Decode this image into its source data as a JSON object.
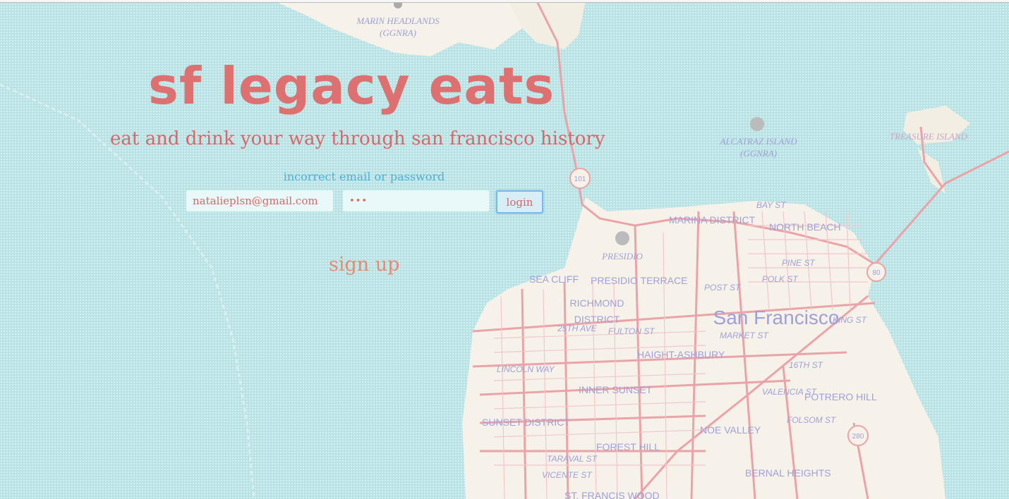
{
  "header": {
    "title": "sf legacy eats",
    "subtitle": "eat and drink your way through san francisco history"
  },
  "login_form": {
    "error_message": "incorrect email or password",
    "email_value": "natalieplsn@gmail.com",
    "password_value": "•••",
    "login_label": "login"
  },
  "signup_label": "sign up",
  "map": {
    "labels": {
      "marin_headlands_1": "MARIN HEADLANDS",
      "marin_headlands_2": "(GGNRA)",
      "alcatraz_1": "ALCATRAZ ISLAND",
      "alcatraz_2": "(GGNRA)",
      "treasure_island": "TREASURE ISLAND",
      "marina": "MARINA DISTRICT",
      "north_beach": "NORTH BEACH",
      "bay_st": "BAY ST",
      "presidio": "PRESIDIO",
      "sea_cliff": "SEA CLIFF",
      "presidio_terrace": "PRESIDIO TERRACE",
      "post_st": "POST ST",
      "pine_st": "PINE ST",
      "polk_st": "POLK ST",
      "richmond_1": "RICHMOND",
      "richmond_2": "DISTRICT",
      "twentyfifth_ave": "25TH AVE",
      "fulton_st": "FULTON ST",
      "san_francisco": "San Francisco",
      "haight": "HAIGHT-ASHBURY",
      "market_st": "MARKET ST",
      "king_st": "KING ST",
      "lincoln_way": "LINCOLN WAY",
      "inner_sunset": "INNER SUNSET",
      "sixteenth_st": "16TH ST",
      "valencia_st": "VALENCIA ST",
      "folsom_st": "FOLSOM ST",
      "potrero": "POTRERO HILL",
      "sunset": "SUNSET DISTRICT",
      "noe": "NOE VALLEY",
      "forest_hill": "FOREST HILL",
      "taraval": "TARAVAL ST",
      "vicente": "VICENTE ST",
      "bernal": "BERNAL HEIGHTS",
      "st_francis": "ST. FRANCIS WOOD",
      "hwy_101": "101",
      "hwy_80": "80",
      "hwy_280": "280"
    },
    "colors": {
      "water": "#b8e2e3",
      "land": "#f6f2ea",
      "road": "#eaa3a8",
      "label": "#a0a0d8"
    }
  },
  "colors": {
    "title": "#dd7070",
    "error": "#4db0d6",
    "signup": "#e68a74",
    "button_border": "#7ab8ea"
  }
}
